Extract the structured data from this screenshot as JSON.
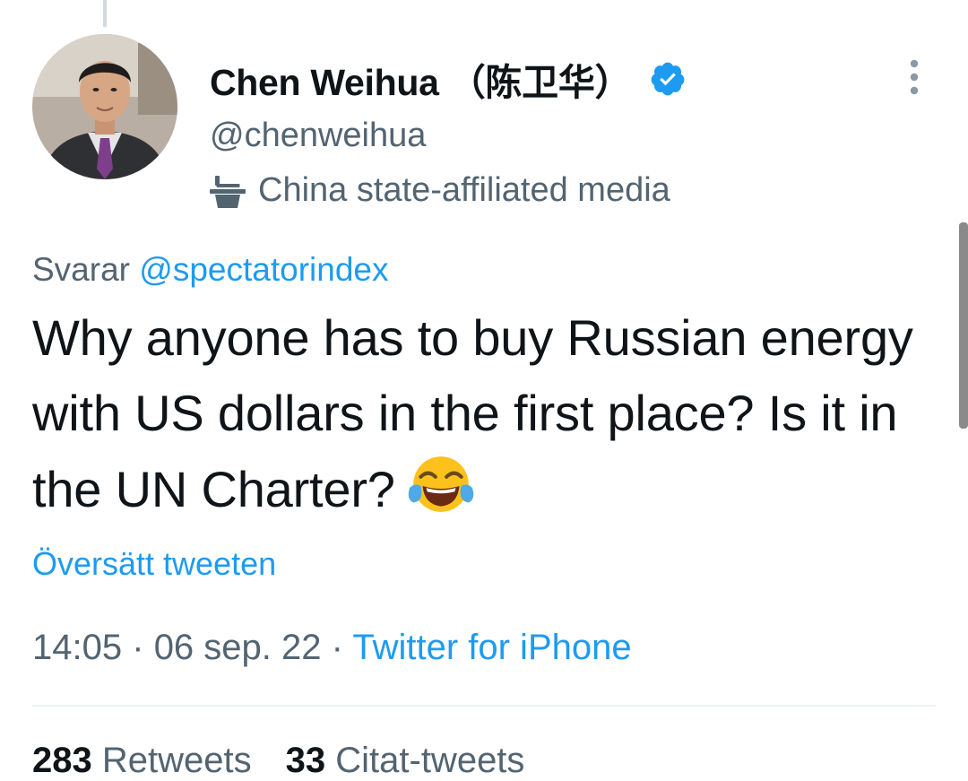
{
  "author": {
    "display_name": "Chen Weihua  （陈卫华）",
    "handle": "@chenweihua",
    "affiliation_label": "China state-affiliated media",
    "verified": true
  },
  "tweet": {
    "reply_prefix": "Svarar",
    "reply_to": "@spectatorindex",
    "text": "Why anyone has to buy Russian energy with US dollars in the first place? Is it in the UN Charter?",
    "emoji": "face-with-tears-of-joy",
    "translate_label": "Översätt tweeten",
    "time": "14:05",
    "date": "06 sep. 22",
    "source": "Twitter for iPhone",
    "separator": "·"
  },
  "stats": {
    "retweets_count": "283",
    "retweets_label": "Retweets",
    "quotes_count": "33",
    "quotes_label": "Citat-tweets"
  },
  "icons": {
    "verified": "verified-badge-icon",
    "more": "more-vertical-icon",
    "affiliation": "podium-icon"
  },
  "colors": {
    "accent": "#1d9bf0",
    "secondary_text": "#536471",
    "primary_text": "#0f1419"
  }
}
